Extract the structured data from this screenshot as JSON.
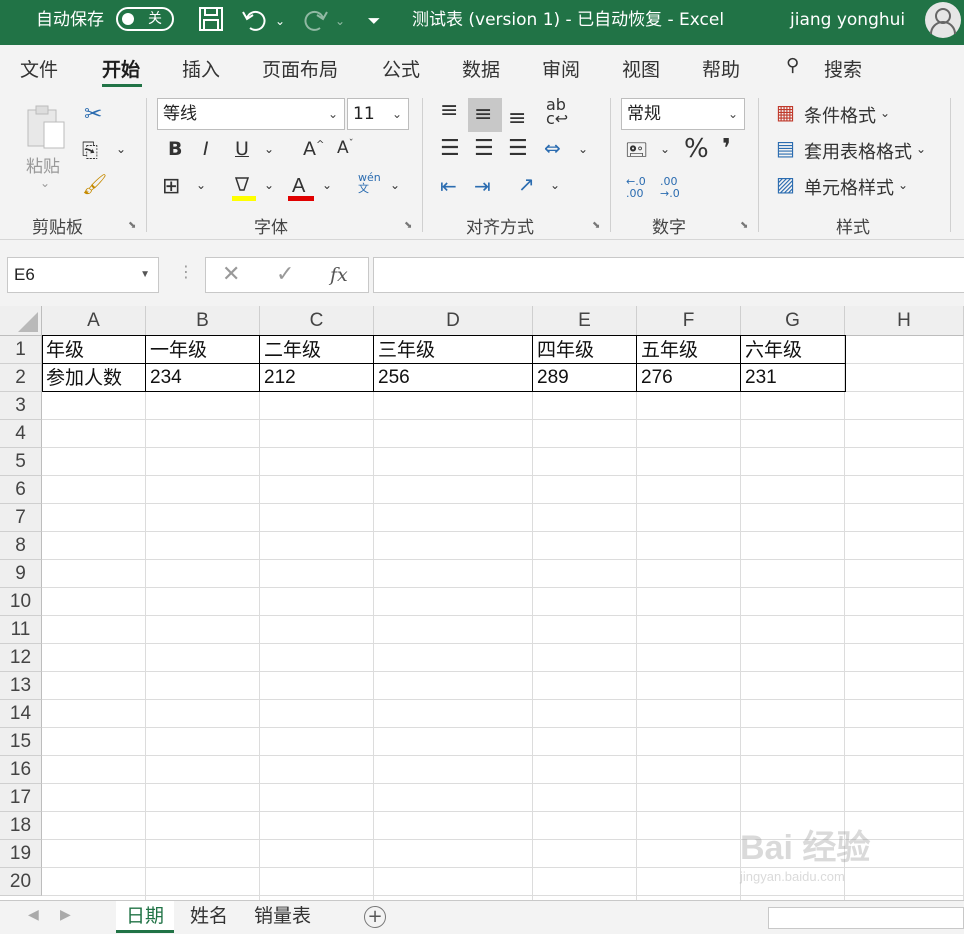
{
  "titlebar": {
    "autosave_label": "自动保存",
    "autosave_state": "关",
    "document_title": "测试表 (version 1)  -  已自动恢复  -  Excel",
    "user_name": "jiang yonghui"
  },
  "menu": {
    "tabs": [
      "文件",
      "开始",
      "插入",
      "页面布局",
      "公式",
      "数据",
      "审阅",
      "视图",
      "帮助"
    ],
    "active_tab": "开始",
    "search_label": "搜索"
  },
  "ribbon": {
    "clipboard": {
      "paste": "粘贴",
      "group": "剪贴板"
    },
    "font": {
      "name": "等线",
      "size": "11",
      "group": "字体",
      "phonetic": "wén\n文"
    },
    "alignment": {
      "group": "对齐方式"
    },
    "number": {
      "format": "常规",
      "group": "数字",
      "percent": "%",
      "comma": "❜",
      "inc_decimal": "←.0\n.00",
      "dec_decimal": ".00\n→.0"
    },
    "styles": {
      "conditional": "条件格式",
      "table": "套用表格格式",
      "cell": "单元格样式",
      "group": "样式"
    }
  },
  "formula_bar": {
    "name_box": "E6",
    "formula": ""
  },
  "grid": {
    "columns": [
      "A",
      "B",
      "C",
      "D",
      "E",
      "F",
      "G",
      "H"
    ],
    "rows": [
      "1",
      "2",
      "3",
      "4",
      "5",
      "6",
      "7",
      "8",
      "9",
      "10",
      "11",
      "12",
      "13",
      "14",
      "15",
      "16",
      "17",
      "18",
      "19",
      "20"
    ],
    "row1": [
      "年级",
      "一年级",
      "二年级",
      "三年级",
      "四年级",
      "五年级",
      "六年级"
    ],
    "row2": [
      "参加人数",
      "234",
      "212",
      "256",
      "289",
      "276",
      "231"
    ]
  },
  "sheets": {
    "tabs": [
      "日期",
      "姓名",
      "销量表"
    ],
    "active": "日期"
  },
  "watermark": {
    "brand": "Bai 经验",
    "url": "jingyan.baidu.com"
  },
  "colors": {
    "accent": "#217346"
  }
}
